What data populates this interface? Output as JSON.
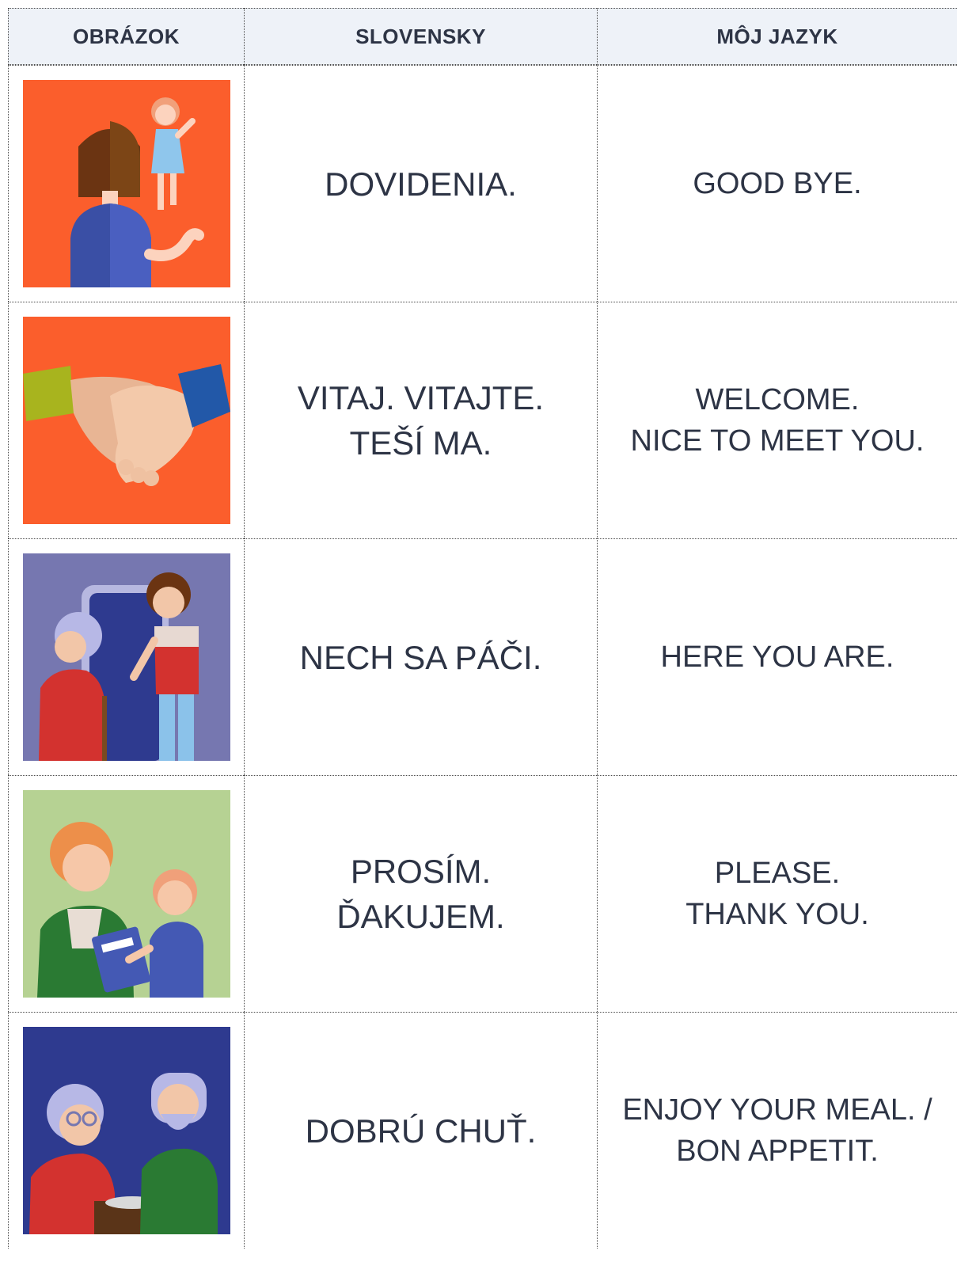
{
  "header": {
    "col_image": "OBRÁZOK",
    "col_slovak": "SLOVENSKY",
    "col_my_language": "MÔJ JAZYK"
  },
  "rows": [
    {
      "image": "goodbye-illustration",
      "slovak": "DOVIDENIA.",
      "my_language": "GOOD BYE."
    },
    {
      "image": "handshake-illustration",
      "slovak": "VITAJ. VITAJTE.\nTEŠÍ MA.",
      "my_language": "WELCOME.\nNICE TO MEET YOU."
    },
    {
      "image": "door-greeting-illustration",
      "slovak": "NECH SA PÁČI.",
      "my_language": "HERE YOU ARE."
    },
    {
      "image": "giving-notebook-illustration",
      "slovak": "PROSÍM.\nĎAKUJEM.",
      "my_language": "PLEASE.\nTHANK YOU."
    },
    {
      "image": "eating-couple-illustration",
      "slovak": "DOBRÚ CHUŤ.",
      "my_language": "ENJOY YOUR MEAL. /\nBON APPETIT."
    }
  ],
  "colors": {
    "header_bg": "#eef2f8",
    "text": "#2d3445",
    "orange_bg": "#fb5e2c",
    "purple_bg": "#7677b0",
    "green_bg": "#b6d293",
    "navy_bg": "#2e3a8f"
  }
}
